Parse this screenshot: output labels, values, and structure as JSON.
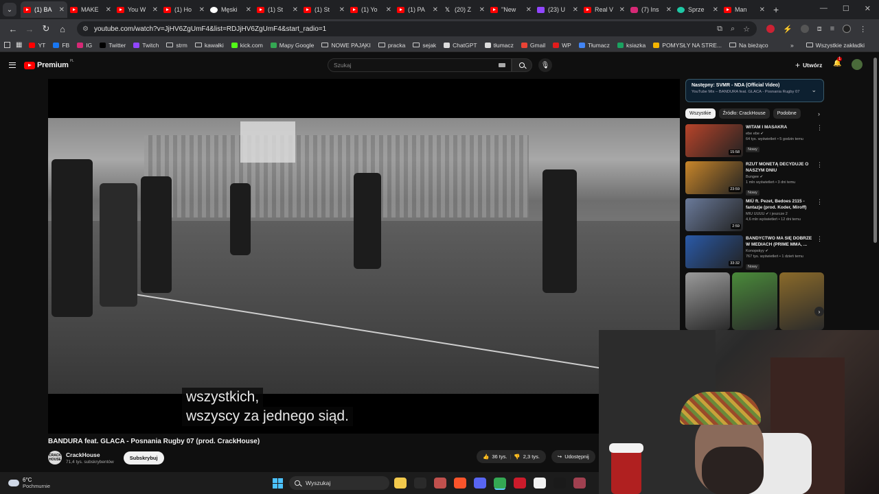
{
  "browser": {
    "tabs": [
      {
        "title": "(1) BA",
        "icon": "youtube-icon",
        "active": true
      },
      {
        "title": "MAKE",
        "icon": "youtube-icon"
      },
      {
        "title": "You W",
        "icon": "youtube-icon"
      },
      {
        "title": "(1) Ho",
        "icon": "youtube-icon"
      },
      {
        "title": "Męski",
        "icon": "white-circle-icon"
      },
      {
        "title": "(1) St",
        "icon": "youtube-icon"
      },
      {
        "title": "(1) St",
        "icon": "youtube-icon"
      },
      {
        "title": "(1) Yo",
        "icon": "youtube-icon"
      },
      {
        "title": "(1) PA",
        "icon": "youtube-icon"
      },
      {
        "title": "(20) Z",
        "icon": "x-icon"
      },
      {
        "title": "\"New",
        "icon": "youtube-icon"
      },
      {
        "title": "(23) U",
        "icon": "twitch-icon"
      },
      {
        "title": "Real V",
        "icon": "youtube-icon"
      },
      {
        "title": "(7) Ins",
        "icon": "instagram-icon"
      },
      {
        "title": "Sprze",
        "icon": "green-circle-icon"
      },
      {
        "title": "Man ",
        "icon": "youtube-icon"
      }
    ],
    "close_glyph": "✕",
    "new_tab_glyph": "+",
    "url": "youtube.com/watch?v=JjHV6ZgUmF4&list=RDJjHV6ZgUmF4&start_radio=1",
    "bookmarks": [
      {
        "label": "YT",
        "icon": "youtube-icon",
        "color": "#ff0000"
      },
      {
        "label": "FB",
        "icon": "facebook-icon",
        "color": "#1877f2"
      },
      {
        "label": "IG",
        "icon": "instagram-icon",
        "color": "#d62976"
      },
      {
        "label": "Twitter",
        "icon": "x-icon",
        "color": "#000000"
      },
      {
        "label": "Twitch",
        "icon": "twitch-icon",
        "color": "#9146ff"
      },
      {
        "label": "strm",
        "icon": "folder-icon"
      },
      {
        "label": "kawałki",
        "icon": "folder-icon"
      },
      {
        "label": "kick.com",
        "icon": "kick-icon",
        "color": "#53fc18"
      },
      {
        "label": "Mapy Google",
        "icon": "maps-icon",
        "color": "#34a853"
      },
      {
        "label": "NOWE PAJĄKI",
        "icon": "folder-icon"
      },
      {
        "label": "pracka",
        "icon": "folder-icon"
      },
      {
        "label": "sejak",
        "icon": "folder-icon"
      },
      {
        "label": "ChatGPT",
        "icon": "chatgpt-icon",
        "color": "#dddddd"
      },
      {
        "label": "tłumacz",
        "icon": "translate-icon",
        "color": "#dddddd"
      },
      {
        "label": "Gmail",
        "icon": "gmail-icon",
        "color": "#ea4335"
      },
      {
        "label": "WP",
        "icon": "wp-icon",
        "color": "#e21b1b"
      },
      {
        "label": "Tłumacz",
        "icon": "translate-icon",
        "color": "#4285f4"
      },
      {
        "label": "ksiazka",
        "icon": "book-icon",
        "color": "#1aa260"
      },
      {
        "label": "POMYSŁY NA STRE...",
        "icon": "docs-icon",
        "color": "#f4b400"
      },
      {
        "label": "Na bieżąco",
        "icon": "folder-icon"
      }
    ],
    "bookmarks_more": "»",
    "all_bookmarks": "Wszystkie zakładki"
  },
  "youtube": {
    "logo_text": "Premium",
    "logo_region": "PL",
    "search_placeholder": "Szukaj",
    "create_label": "Utwórz",
    "notifications_count": "1",
    "video": {
      "title": "BANDURA feat. GLACA - Posnania Rugby 07 (prod. CrackHouse)",
      "subtitle_line1": "wszystkich,",
      "subtitle_line2": "wszyscy za jednego siąd.",
      "channel": "CrackHouse",
      "channel_avatar_text": "CRACK HOUSE",
      "subscribers": "71,4 tys. subskrybentów",
      "subscribe_label": "Subskrybuj",
      "likes": "36 tys.",
      "dislikes": "2,3 tys.",
      "share_label": "Udostępnij"
    },
    "up_next": {
      "title": "Następny: SVMR - NDA (Official Video)",
      "subtitle": "YouTube Mix – BANDURA feat. GLACA - Posnania Rugby 07"
    },
    "chips": [
      "Wszystkie",
      "Źródło: CrackHouse",
      "Podobne"
    ],
    "recommendations": [
      {
        "title": "WITAM I MASAKRA",
        "channel": "ebe ebe",
        "meta": "64 tys. wyświetleń • 5 godzin temu",
        "badge": "Nowy",
        "duration": "15:58",
        "thumb_color": "#b8442a"
      },
      {
        "title": "RZUT MONETĄ DECYDUJE O NASZYM DNIU",
        "channel": "Bungee",
        "meta": "1 mln wyświetleń • 3 dni temu",
        "badge": "Nowy",
        "duration": "23:59",
        "thumb_color": "#c8862a"
      },
      {
        "title": "MIÜ ft. Pezet, Bedoes 2115 - fantazje (prod. Koder, Miroff)",
        "channel": "MIÜ ÜÜÜÜ",
        "channel_extra": "i jeszcze 2",
        "meta": "4,6 mln wyświetleń • 12 dni temu",
        "badge": "",
        "duration": "2:59",
        "thumb_color": "#6a7a9a"
      },
      {
        "title": "BANDYCTWO MA SIĘ DOBRZE W MEDIACH (PRIME MMA, ...",
        "channel": "Konopskyy",
        "meta": "767 tys. wyświetleń • 1 dzień temu",
        "badge": "Nowy",
        "duration": "33:32",
        "thumb_color": "#2a5aa8"
      }
    ],
    "shorts": [
      {
        "thumb_color": "#9a9a9a"
      },
      {
        "thumb_color": "#4a8a3a"
      },
      {
        "thumb_color": "#8a6a2a"
      }
    ]
  },
  "taskbar": {
    "temperature": "6°C",
    "weather": "Pochmurnie",
    "search_label": "Wyszukaj",
    "apps": [
      {
        "name": "file-explorer-icon",
        "color": "#f2c94c"
      },
      {
        "name": "steam-icon",
        "color": "#2a2a2a"
      },
      {
        "name": "photo-app-icon",
        "color": "#c0504d"
      },
      {
        "name": "brave-icon",
        "color": "#fb542b"
      },
      {
        "name": "discord-icon",
        "color": "#5865f2"
      },
      {
        "name": "chrome-icon",
        "color": "#34a853",
        "active": true
      },
      {
        "name": "opera-icon",
        "color": "#cc1b2b"
      },
      {
        "name": "capcut-icon",
        "color": "#f2f2f2"
      },
      {
        "name": "app-icon",
        "color": "#1a1a1a"
      },
      {
        "name": "game-icon",
        "color": "#a04050"
      }
    ]
  }
}
